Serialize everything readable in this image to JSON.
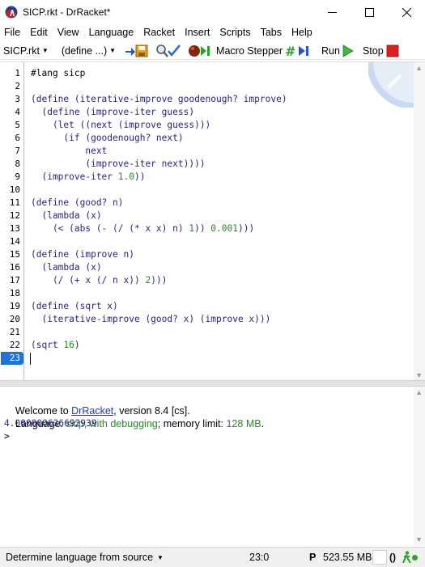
{
  "window": {
    "title": "SICP.rkt - DrRacket*"
  },
  "menu": {
    "items": [
      "File",
      "Edit",
      "View",
      "Language",
      "Racket",
      "Insert",
      "Scripts",
      "Tabs",
      "Help"
    ]
  },
  "toolbar": {
    "file_dropdown": "SICP.rkt",
    "define_dropdown": "(define ...)",
    "macro_stepper_label": "Macro Stepper",
    "run_label": "Run",
    "stop_label": "Stop"
  },
  "editor": {
    "line_numbers": [
      "1",
      "2",
      "3",
      "4",
      "5",
      "6",
      "7",
      "8",
      "9",
      "10",
      "11",
      "12",
      "13",
      "14",
      "15",
      "16",
      "17",
      "18",
      "19",
      "20",
      "21",
      "22",
      "23"
    ],
    "active_line": "23",
    "lines": [
      [
        {
          "t": "#lang sicp",
          "c": "plain"
        }
      ],
      [],
      [
        {
          "t": "(define (iterative-improve goodenough? improve)",
          "c": "kw"
        }
      ],
      [
        {
          "t": "  (define (improve-iter guess)",
          "c": "kw"
        }
      ],
      [
        {
          "t": "    (let ((next (improve guess)))",
          "c": "kw"
        }
      ],
      [
        {
          "t": "      (if (goodenough? next)",
          "c": "kw"
        }
      ],
      [
        {
          "t": "          next",
          "c": "kw"
        }
      ],
      [
        {
          "t": "          (improve-iter next))))",
          "c": "kw"
        }
      ],
      [
        {
          "t": "  (improve-iter ",
          "c": "kw"
        },
        {
          "t": "1.0",
          "c": "num"
        },
        {
          "t": "))",
          "c": "kw"
        }
      ],
      [],
      [
        {
          "t": "(define (good? n)",
          "c": "kw"
        }
      ],
      [
        {
          "t": "  (lambda (x)",
          "c": "kw"
        }
      ],
      [
        {
          "t": "    (< (abs (- (/ (* x x) n) ",
          "c": "kw"
        },
        {
          "t": "1",
          "c": "num"
        },
        {
          "t": ")) ",
          "c": "kw"
        },
        {
          "t": "0.001",
          "c": "num"
        },
        {
          "t": ")))",
          "c": "kw"
        }
      ],
      [],
      [
        {
          "t": "(define (improve n)",
          "c": "kw"
        }
      ],
      [
        {
          "t": "  (lambda (x)",
          "c": "kw"
        }
      ],
      [
        {
          "t": "    (/ (+ x (/ n x)) ",
          "c": "kw"
        },
        {
          "t": "2",
          "c": "num"
        },
        {
          "t": ")))",
          "c": "kw"
        }
      ],
      [],
      [
        {
          "t": "(define (sqrt x)",
          "c": "kw"
        }
      ],
      [
        {
          "t": "  (iterative-improve (good? x) (improve x)))",
          "c": "kw"
        }
      ],
      [],
      [
        {
          "t": "(sqrt ",
          "c": "kw"
        },
        {
          "t": "16",
          "c": "num"
        },
        {
          "t": ")",
          "c": "kw"
        }
      ],
      []
    ]
  },
  "repl": {
    "welcome_prefix": "Welcome to ",
    "welcome_link": "DrRacket",
    "welcome_suffix": ", version 8.4 [cs].",
    "language_prefix": "Language: ",
    "language_name": "sicp, with debugging",
    "language_mid": "; memory limit: ",
    "memory_limit": "128 MB",
    "language_suffix": ".",
    "output": "4.000000636692939",
    "prompt": ">"
  },
  "status": {
    "language_selector": "Determine language from source",
    "position": "23:0",
    "p_indicator": "P",
    "memory": "523.55 MB",
    "paren_indicator": "()"
  },
  "colors": {
    "keyword": "#262680",
    "number": "#228b22",
    "active_line": "#1d73d8",
    "link": "#1a3ad8"
  }
}
